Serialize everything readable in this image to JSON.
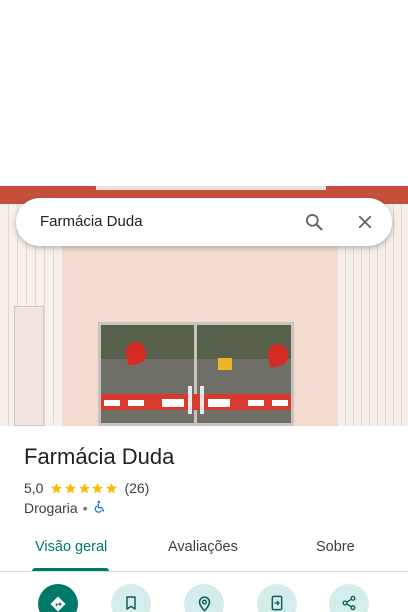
{
  "search": {
    "query": "Farmácia Duda"
  },
  "place": {
    "name": "Farmácia Duda",
    "rating": "5,0",
    "stars": 5,
    "reviews_count": "(26)",
    "category": "Drogaria",
    "separator": "•",
    "accessibility_icon": "wheelchair-icon"
  },
  "tabs": [
    {
      "label": "Visão geral",
      "active": true
    },
    {
      "label": "Avaliações",
      "active": false
    },
    {
      "label": "Sobre",
      "active": false
    }
  ],
  "actions": [
    {
      "icon": "directions-icon",
      "primary": true
    },
    {
      "icon": "bookmark-icon",
      "primary": false
    },
    {
      "icon": "nearby-icon",
      "primary": false
    },
    {
      "icon": "send-to-phone-icon",
      "primary": false
    },
    {
      "icon": "share-icon",
      "primary": false
    }
  ],
  "colors": {
    "accent": "#00796b",
    "action_bg": "#d3eeea",
    "star": "#fbbc04",
    "accessibility": "#1a73e8"
  }
}
